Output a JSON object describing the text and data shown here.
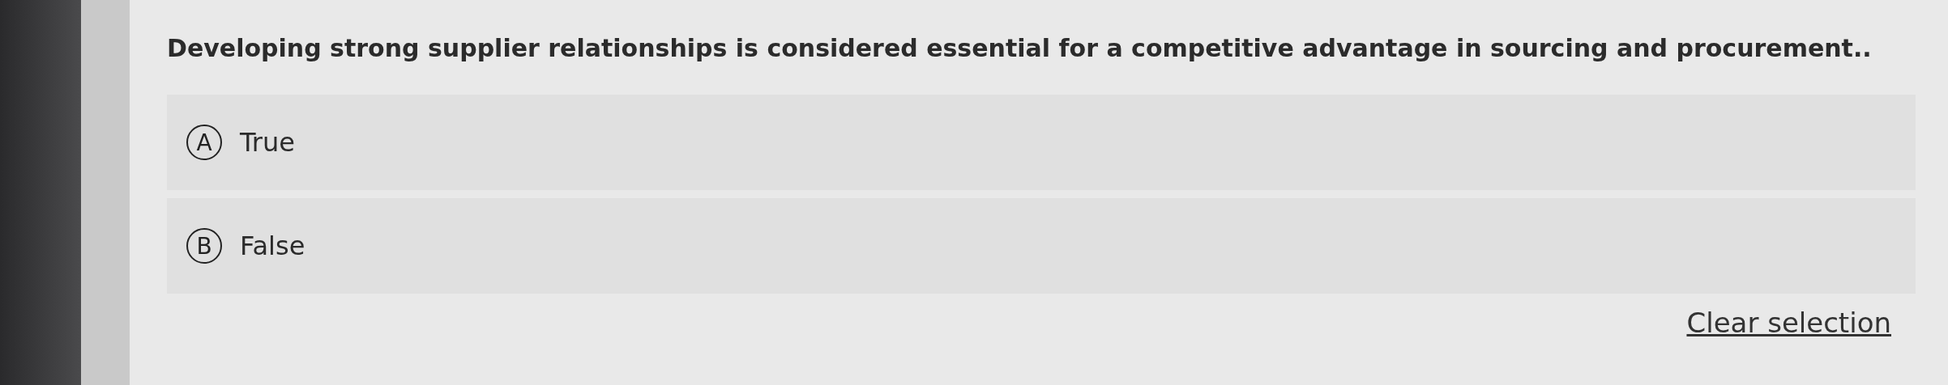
{
  "question": "Developing strong supplier relationships is considered essential for a competitive advantage in sourcing and procurement..",
  "options": [
    {
      "letter": "A",
      "label": "True",
      "selected": false
    },
    {
      "letter": "B",
      "label": "False",
      "selected": false
    }
  ],
  "clear_link": "Clear selection"
}
